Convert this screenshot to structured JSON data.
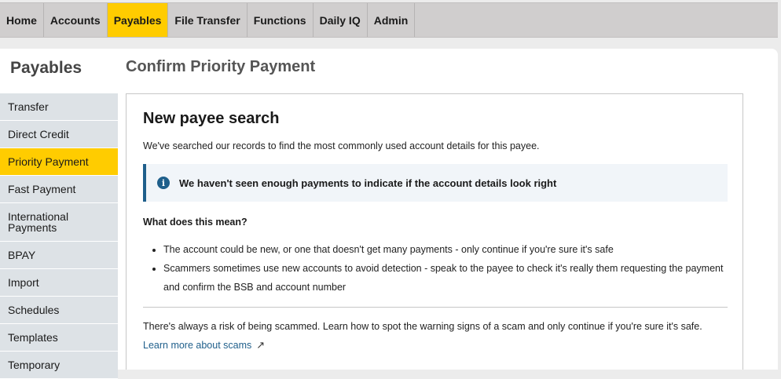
{
  "nav": {
    "tabs": [
      {
        "label": "Home"
      },
      {
        "label": "Accounts"
      },
      {
        "label": "Payables"
      },
      {
        "label": "File Transfer"
      },
      {
        "label": "Functions"
      },
      {
        "label": "Daily IQ"
      },
      {
        "label": "Admin"
      }
    ],
    "active": "Payables"
  },
  "sidebar": {
    "title": "Payables",
    "items": [
      {
        "label": "Transfer"
      },
      {
        "label": "Direct Credit"
      },
      {
        "label": "Priority Payment"
      },
      {
        "label": "Fast Payment"
      },
      {
        "label": "International Payments"
      },
      {
        "label": "BPAY"
      },
      {
        "label": "Import"
      },
      {
        "label": "Schedules"
      },
      {
        "label": "Templates"
      },
      {
        "label": "Temporary"
      }
    ]
  },
  "main": {
    "title": "Confirm Priority Payment",
    "card": {
      "title": "New payee search",
      "intro": "We've searched our records to find the most commonly used account details for this payee.",
      "info": "We haven't seen enough payments to indicate if the account details look right",
      "meaning_heading": "What does this mean?",
      "bullets": [
        "The account could be new, or one that doesn't get many payments - only continue if you're sure it's safe",
        "Scammers sometimes use new accounts to avoid detection - speak to the payee to check it's really them requesting the payment and confirm the BSB and account number"
      ],
      "risk": "There's always a risk of being scammed. Learn how to spot the warning signs of a scam and only continue if you're sure it's safe.",
      "learn_more": "Learn more about scams"
    }
  },
  "colors": {
    "accent": "#ffcc00",
    "link": "#1f5f8b",
    "sidebar_bg": "#dde2e6",
    "nav_bg": "#d0cece"
  },
  "icons": {
    "info": "info-icon",
    "external": "external-link-icon"
  }
}
